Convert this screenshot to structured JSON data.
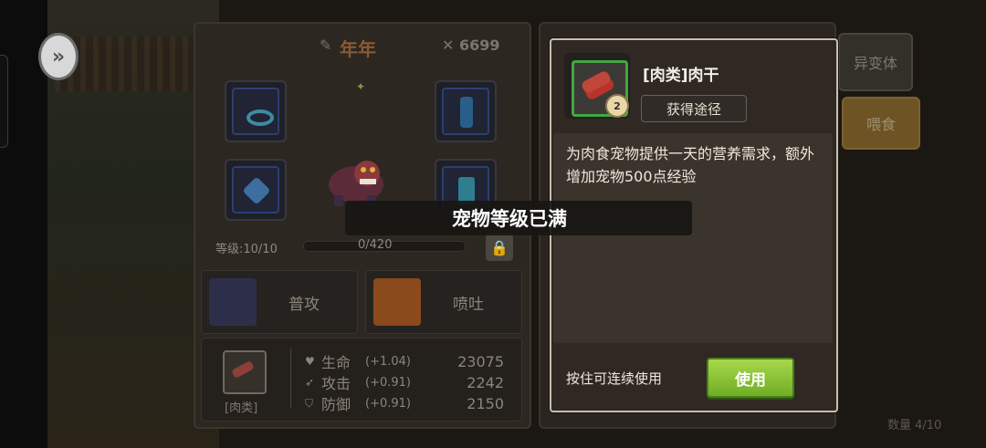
{
  "pet": {
    "name": "年年",
    "power": "6699",
    "level_label": "等级:10/10",
    "exp_text": "0/420",
    "skills": [
      {
        "label": "普攻"
      },
      {
        "label": "喷吐"
      }
    ],
    "food_category": "[肉类]",
    "stats": [
      {
        "name": "生命",
        "growth": "(+1.04)",
        "value": "23075"
      },
      {
        "name": "攻击",
        "growth": "(+0.91)",
        "value": "2242"
      },
      {
        "name": "防御",
        "growth": "(+0.91)",
        "value": "2150"
      }
    ]
  },
  "right_panel": {
    "mutant_label": "异变体",
    "feed_label": "喂食",
    "quantity_label": "数量 4/10"
  },
  "toast": {
    "message": "宠物等级已满"
  },
  "item_popup": {
    "name": "[肉类]肉干",
    "count_badge": "2",
    "source_label": "获得途径",
    "description": "为肉食宠物提供一天的营养需求，额外增加宠物500点经验",
    "hold_hint": "按住可连续使用",
    "use_label": "使用"
  },
  "colors": {
    "use_button": "#7fc233",
    "item_frame": "#43a742",
    "popup_border": "#c9c0ae"
  }
}
